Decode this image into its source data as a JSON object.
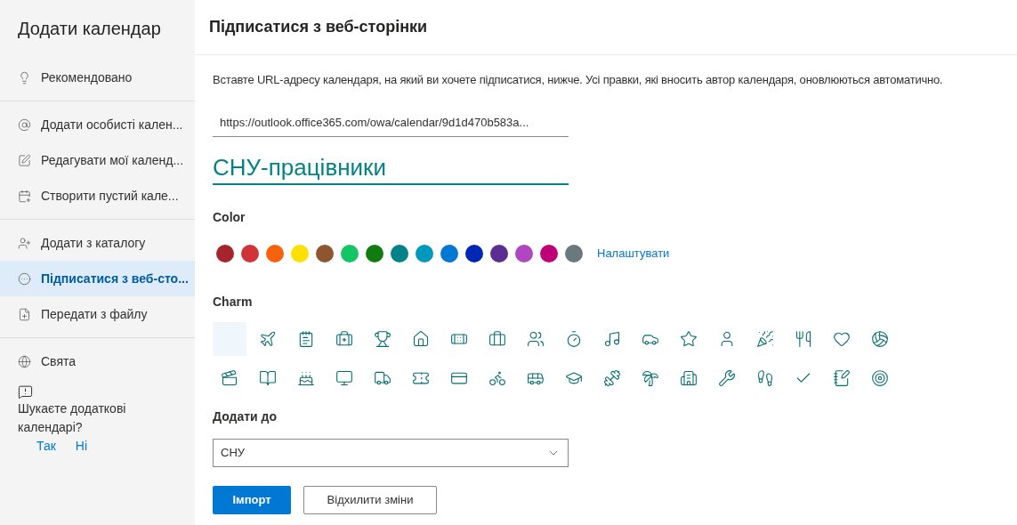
{
  "sidebar": {
    "title": "Додати календар",
    "sections": [
      [
        {
          "label": "Рекомендовано",
          "selected": false
        }
      ],
      [
        {
          "label": "Додати особисті кален...",
          "selected": false
        },
        {
          "label": "Редагувати мої календ...",
          "selected": false
        },
        {
          "label": "Створити пустий кале...",
          "selected": false
        }
      ],
      [
        {
          "label": "Додати з каталогу",
          "selected": false
        },
        {
          "label": "Підписатися з веб-сто...",
          "selected": true
        },
        {
          "label": "Передати з файлу",
          "selected": false
        }
      ],
      [
        {
          "label": "Свята",
          "selected": false
        }
      ]
    ],
    "prompt": {
      "text": "Шукаєте додаткові календарі?",
      "yes": "Так",
      "no": "Ні"
    }
  },
  "header": {
    "title": "Підписатися з веб-сторінки"
  },
  "description": "Вставте URL-адресу календаря, на який ви хочете підписатися, нижче. Усі правки, які вносить автор календаря, оновлюються автоматично.",
  "url_field": {
    "value": "https://outlook.office365.com/owa/calendar/9d1d470b583a..."
  },
  "name_field": {
    "value": "СНУ-працівники"
  },
  "color": {
    "label": "Color",
    "customize": "Налаштувати",
    "swatches": [
      {
        "color": "#a4262c"
      },
      {
        "color": "#d13438"
      },
      {
        "color": "#f7630c"
      },
      {
        "color": "#fce100"
      },
      {
        "color": "#8e562e"
      },
      {
        "color": "#13c565"
      },
      {
        "color": "#107c10"
      },
      {
        "color": "#038387"
      },
      {
        "color": "#0099bc"
      },
      {
        "color": "#0078d4"
      },
      {
        "color": "#0027b4"
      },
      {
        "color": "#5c2e91"
      },
      {
        "color": "#b146c2"
      },
      {
        "color": "#bf0077"
      },
      {
        "color": "#69797e"
      }
    ]
  },
  "charm": {
    "label": "Charm",
    "items": [
      {
        "selected": true
      },
      {
        "selected": false
      },
      {
        "selected": false
      },
      {
        "selected": false
      },
      {
        "selected": false
      },
      {
        "selected": false
      },
      {
        "selected": false
      },
      {
        "selected": false
      },
      {
        "selected": false
      },
      {
        "selected": false
      },
      {
        "selected": false
      },
      {
        "selected": false
      },
      {
        "selected": false
      },
      {
        "selected": false
      },
      {
        "selected": false
      },
      {
        "selected": false
      },
      {
        "selected": false
      },
      {
        "selected": false
      },
      {
        "selected": false
      },
      {
        "selected": false
      },
      {
        "selected": false
      },
      {
        "selected": false
      },
      {
        "selected": false
      },
      {
        "selected": false
      },
      {
        "selected": false
      },
      {
        "selected": false
      },
      {
        "selected": false
      },
      {
        "selected": false
      },
      {
        "selected": false
      },
      {
        "selected": false
      },
      {
        "selected": false
      },
      {
        "selected": false
      },
      {
        "selected": false
      },
      {
        "selected": false
      },
      {
        "selected": false
      },
      {
        "selected": false
      }
    ]
  },
  "add_to": {
    "label": "Додати до",
    "value": "СНУ"
  },
  "buttons": {
    "import": "Імпорт",
    "discard": "Відхилити зміни"
  }
}
